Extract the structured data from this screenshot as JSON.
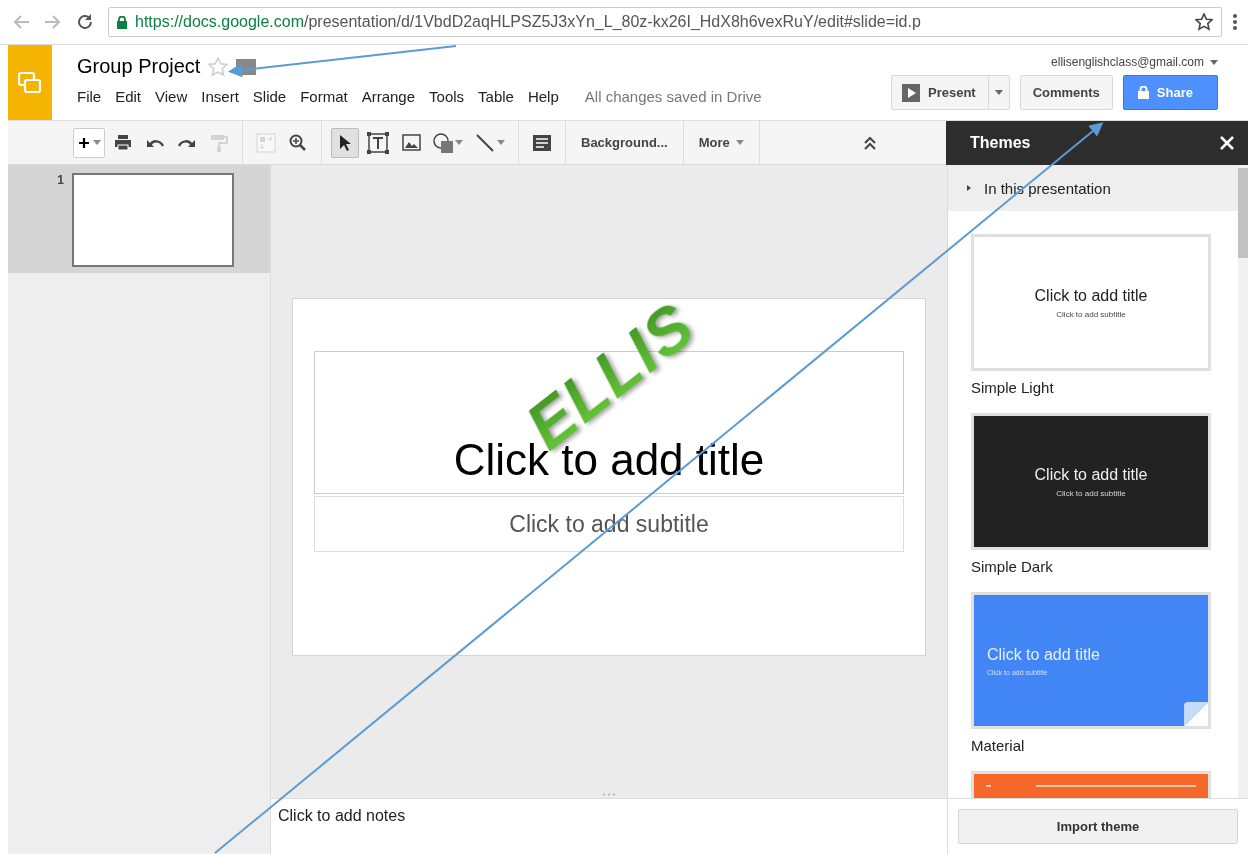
{
  "browser": {
    "url_host": "https://docs.google.com",
    "url_path": "/presentation/d/1VbdD2aqHLPSZ5J3xYn_L_80z-kx26I_HdX8h6vexRuY/edit#slide=id.p"
  },
  "document": {
    "title": "Group Project",
    "starred": false
  },
  "menu": [
    "File",
    "Edit",
    "View",
    "Insert",
    "Slide",
    "Format",
    "Arrange",
    "Tools",
    "Table",
    "Help"
  ],
  "save_status": "All changes saved in Drive",
  "account": {
    "email": "ellisenglishclass@gmail.com"
  },
  "buttons": {
    "present": "Present",
    "comments": "Comments",
    "share": "Share"
  },
  "tools": [
    {
      "kind": "new",
      "selected": false,
      "disabled": false
    },
    {
      "kind": "print",
      "selected": false,
      "disabled": false
    },
    {
      "kind": "undo",
      "selected": false,
      "disabled": false
    },
    {
      "kind": "redo",
      "selected": false,
      "disabled": false
    },
    {
      "kind": "paint",
      "selected": false,
      "disabled": true
    },
    {
      "kind": "layout",
      "selected": false,
      "disabled": true
    },
    {
      "kind": "zoom",
      "selected": false,
      "disabled": false
    },
    {
      "kind": "select",
      "selected": true,
      "disabled": false
    },
    {
      "kind": "textbox",
      "selected": false,
      "disabled": false
    },
    {
      "kind": "image",
      "selected": false,
      "disabled": false
    },
    {
      "kind": "shape",
      "selected": false,
      "disabled": false
    },
    {
      "kind": "line",
      "selected": false,
      "disabled": false
    },
    {
      "kind": "comment",
      "selected": false,
      "disabled": false
    }
  ],
  "toolbar_menus": [
    "Background...",
    "More"
  ],
  "slides": [
    {
      "number": "1",
      "selected": true
    }
  ],
  "slide": {
    "wordart": "ELLIS",
    "title_placeholder": "Click to add title",
    "subtitle_placeholder": "Click to add subtitle"
  },
  "notes": {
    "placeholder": "Click to add notes"
  },
  "themes_panel": {
    "title": "Themes",
    "section": "In this presentation",
    "section_expanded": false,
    "themes": [
      {
        "kind": "light",
        "name": "Simple Light",
        "title_text": "Click to add title",
        "subtitle_text": "Click to add subtitle"
      },
      {
        "kind": "dark",
        "name": "Simple Dark",
        "title_text": "Click to add title",
        "subtitle_text": "Click to add subtitle"
      },
      {
        "kind": "material",
        "name": "Material",
        "title_text": "Click to add title",
        "subtitle_text": "Click to add subtitle"
      },
      {
        "kind": "orange"
      }
    ],
    "import_button": "Import theme"
  }
}
